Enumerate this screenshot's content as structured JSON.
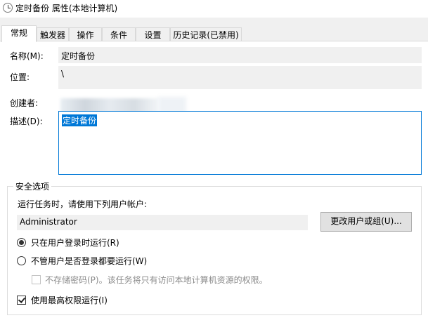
{
  "window": {
    "title": "定时备份 属性(本地计算机)"
  },
  "tabs": [
    {
      "label": "常规",
      "active": true
    },
    {
      "label": "触发器"
    },
    {
      "label": "操作"
    },
    {
      "label": "条件"
    },
    {
      "label": "设置"
    },
    {
      "label": "历史记录(已禁用)"
    }
  ],
  "general": {
    "name_label": "名称(M):",
    "name_value": "定时备份",
    "location_label": "位置:",
    "location_value": "\\",
    "author_label": "创建者:",
    "description_label": "描述(D):",
    "description_value": "定时备份"
  },
  "security": {
    "group_title": "安全选项",
    "prompt": "运行任务时，请使用下列用户帐户:",
    "user_account": "Administrator",
    "change_button": "更改用户或组(U)...",
    "radio_logged_on": "只在用户登录时运行(R)",
    "radio_whether_logged": "不管用户是否登录都要运行(W)",
    "no_store_password": "不存储密码(P)。该任务将只有访问本地计算机资源的权限。",
    "highest_privileges": "使用最高权限运行(I)",
    "radio_logged_on_selected": true,
    "highest_privileges_checked": true
  }
}
